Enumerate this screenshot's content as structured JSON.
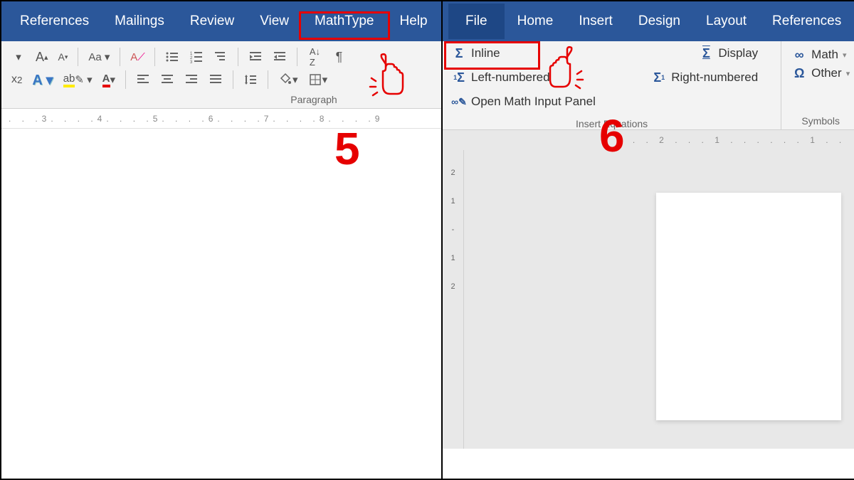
{
  "left": {
    "tabs": [
      "References",
      "Mailings",
      "Review",
      "View",
      "MathType",
      "Help"
    ],
    "group_label": "Paragraph",
    "ruler": ". . .3. . . .4. . . .5. . . .6. . . .7. . . .8. . . .9",
    "step": "5"
  },
  "right": {
    "tabs": [
      "File",
      "Home",
      "Insert",
      "Design",
      "Layout",
      "References"
    ],
    "insert_equations": {
      "items": [
        "Inline",
        "Display",
        "Left-numbered",
        "Right-numbered",
        "Open Math Input Panel"
      ],
      "label": "Insert Equations"
    },
    "symbols": {
      "items": [
        "Math",
        "Other"
      ],
      "label": "Symbols"
    },
    "ruler": ". . 2 . . . 1 . . .        . . . 1 . .",
    "vruler": [
      "2",
      "1",
      "-",
      "1",
      "2"
    ],
    "step": "6"
  }
}
